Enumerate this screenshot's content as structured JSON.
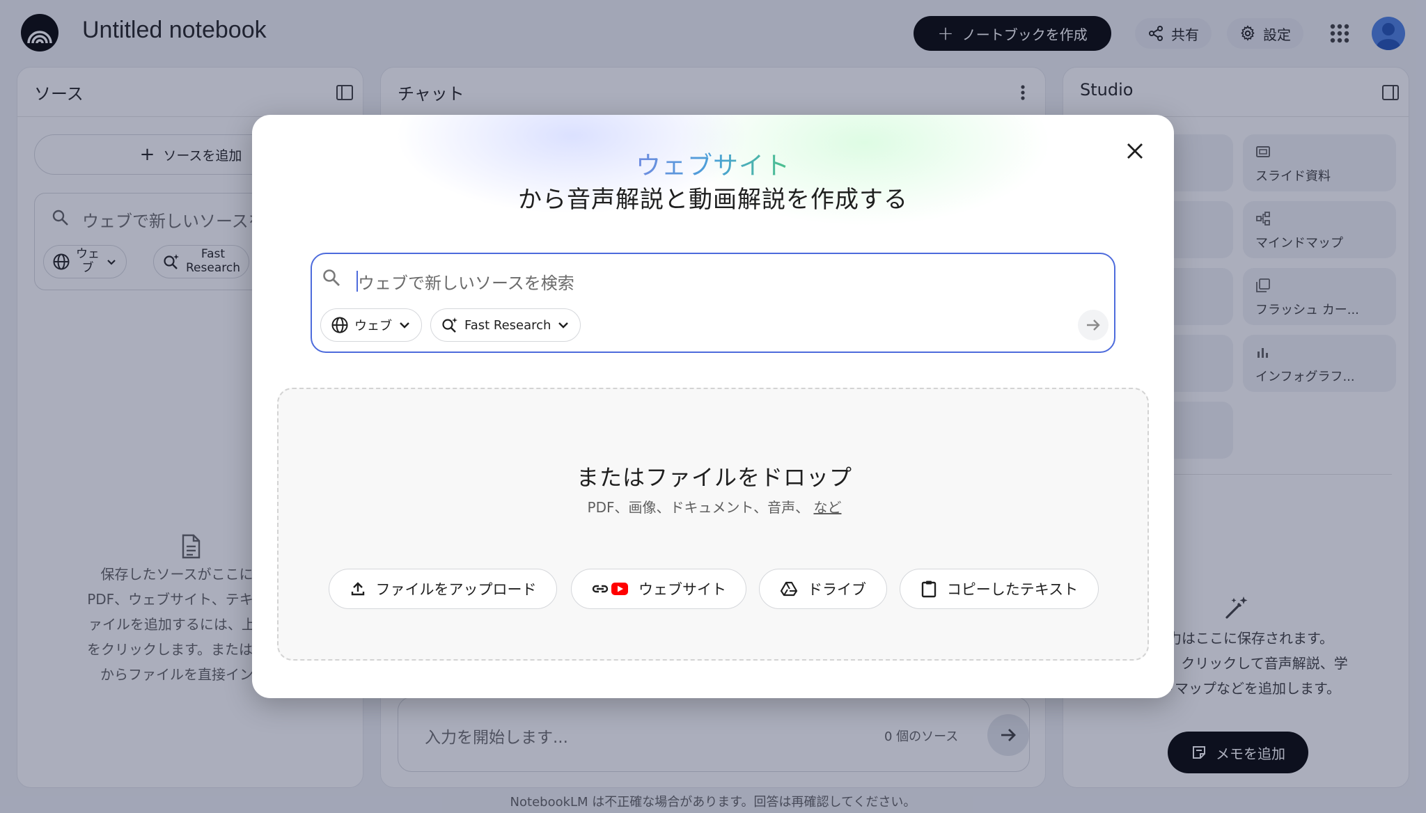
{
  "header": {
    "title": "Untitled notebook",
    "create_label": "ノートブックを作成",
    "share_label": "共有",
    "settings_label": "設定"
  },
  "sources": {
    "title": "ソース",
    "add_label": "ソースを追加",
    "search_placeholder": "ウェブで新しいソースを",
    "chip_web": "ウェ\nブ",
    "chip_fast": "Fast\nResearch",
    "empty_lines": [
      "保存したソースがここに表示",
      "PDF、ウェブサイト、テキスト、",
      "ァイルを追加するには、上の [ソ",
      "をクリックします。または、Goo",
      "からファイルを直接インポー"
    ]
  },
  "chat": {
    "title": "チャット",
    "input_placeholder": "入力を開始します...",
    "source_count": "0 個のソース"
  },
  "studio": {
    "title": "Studio",
    "tiles": [
      "スライド資料",
      "マインドマップ",
      "フラッシュ カー...",
      "インフォグラフ..."
    ],
    "empty_lines": [
      "の出力はここに保存されます。",
      "したら、クリックして音声解説、学",
      "インドマップなどを追加します。"
    ],
    "memo_label": "メモを追加"
  },
  "modal": {
    "heading_highlight": "ウェブサイト",
    "heading_rest": "から音声解説と動画解説を作成する",
    "search_placeholder": "ウェブで新しいソースを検索",
    "chip_web": "ウェブ",
    "chip_fast": "Fast Research",
    "drop_title": "またはファイルをドロップ",
    "drop_sub": "PDF、画像、ドキュメント、音声、",
    "drop_more": "など",
    "btn_upload": "ファイルをアップロード",
    "btn_website": "ウェブサイト",
    "btn_drive": "ドライブ",
    "btn_copy": "コピーしたテキスト"
  },
  "disclaimer": "NotebookLM は不正確な場合があります。回答は再確認してください。",
  "colors": {
    "accent_blue": "#4d6bdc",
    "youtube_red": "#ff0000",
    "primary_black": "#000000"
  }
}
